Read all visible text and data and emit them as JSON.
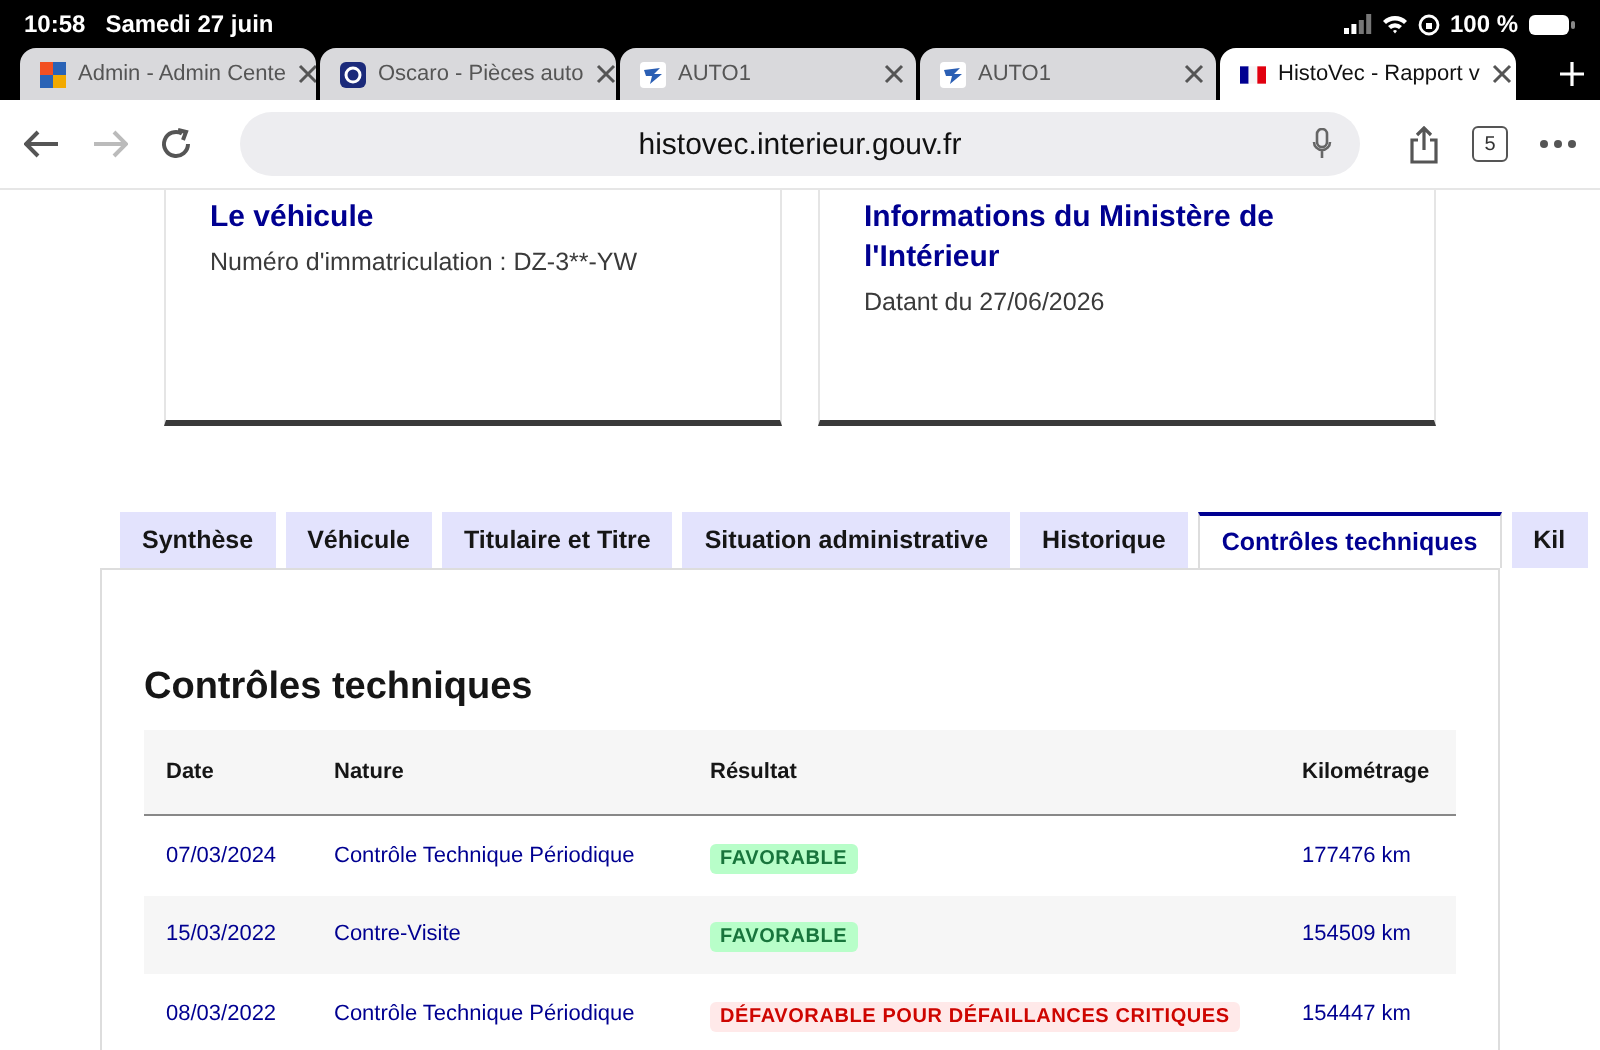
{
  "status_bar": {
    "time": "10:58",
    "date": "Samedi 27 juin",
    "battery": "100 %"
  },
  "browser_tabs": [
    {
      "title": "Admin - Admin Cente",
      "kind": "admin",
      "selected": false
    },
    {
      "title": "Oscaro - Pièces auto",
      "kind": "oscaro",
      "selected": false
    },
    {
      "title": "AUTO1",
      "kind": "auto1",
      "selected": false
    },
    {
      "title": "AUTO1",
      "kind": "auto1",
      "selected": false
    },
    {
      "title": "HistoVec - Rapport v",
      "kind": "flag",
      "selected": true
    }
  ],
  "address_bar": {
    "url": "histovec.interieur.gouv.fr",
    "tab_count": "5"
  },
  "cards": [
    {
      "title": "Le véhicule",
      "lines": [
        "Numéro d'immatriculation : DZ-3**-YW"
      ]
    },
    {
      "title": "Informations du Ministère de l'Intérieur",
      "lines": [
        "Datant du 27/06/2026"
      ]
    }
  ],
  "report_tabs": [
    {
      "label": "Synthèse",
      "selected": false
    },
    {
      "label": "Véhicule",
      "selected": false
    },
    {
      "label": "Titulaire et Titre",
      "selected": false
    },
    {
      "label": "Situation administrative",
      "selected": false
    },
    {
      "label": "Historique",
      "selected": false
    },
    {
      "label": "Contrôles techniques",
      "selected": true
    },
    {
      "label": "Kil",
      "selected": false
    }
  ],
  "section": {
    "heading": "Contrôles techniques",
    "table": {
      "columns": [
        "Date",
        "Nature",
        "Résultat",
        "Kilométrage"
      ],
      "rows": [
        {
          "date": "07/03/2024",
          "nature": "Contrôle Technique Périodique",
          "result": {
            "text": "FAVORABLE",
            "kind": "success"
          },
          "mileage": "177476 km"
        },
        {
          "date": "15/03/2022",
          "nature": "Contre-Visite",
          "result": {
            "text": "FAVORABLE",
            "kind": "success"
          },
          "mileage": "154509 km"
        },
        {
          "date": "08/03/2022",
          "nature": "Contrôle Technique Périodique",
          "result": {
            "text": "DÉFAVORABLE POUR DÉFAILLANCES CRITIQUES",
            "kind": "error"
          },
          "mileage": "154447 km"
        }
      ]
    }
  }
}
